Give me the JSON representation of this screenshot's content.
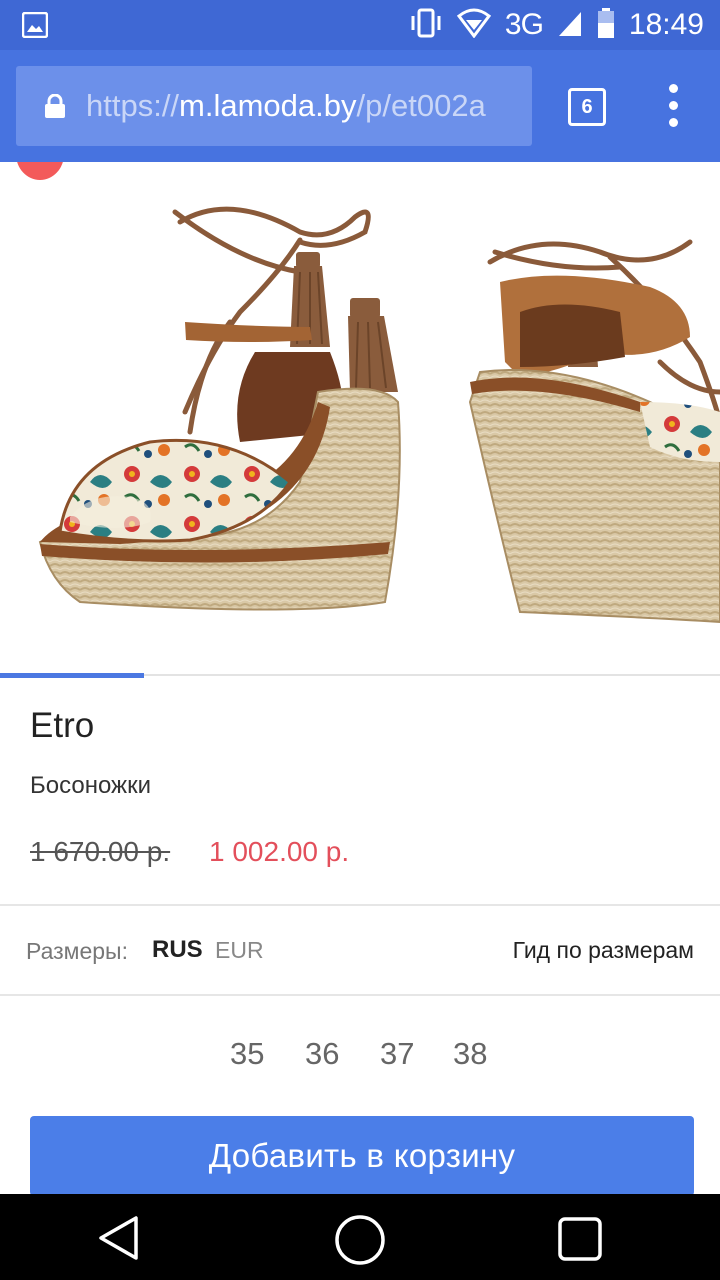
{
  "status_bar": {
    "network": "3G",
    "time": "18:49",
    "icons": [
      "image-notification-icon",
      "vibrate-icon",
      "wifi-icon",
      "signal-icon",
      "battery-icon"
    ]
  },
  "browser": {
    "url_scheme": "https://",
    "url_host": "m.lamoda.by",
    "url_path": "/p/et002a",
    "tab_count": "6",
    "icons": [
      "lock-icon",
      "overflow-menu-icon"
    ]
  },
  "product": {
    "brand": "Etro",
    "type": "Босоножки",
    "price_old": "1 670.00 р.",
    "price_new": "1 002.00 р.",
    "gallery_position": 0.2
  },
  "sizes": {
    "label": "Размеры:",
    "system_active": "RUS",
    "system_other": "EUR",
    "guide_link": "Гид по размерам",
    "values": [
      "35",
      "36",
      "37",
      "38"
    ]
  },
  "actions": {
    "add_to_cart": "Добавить в корзину"
  },
  "colors": {
    "status_bar": "#3f68d4",
    "toolbar": "#4773e0",
    "accent_button": "#4b7ee8",
    "sale_price": "#e34f5b",
    "sale_badge": "#f35a5a"
  }
}
